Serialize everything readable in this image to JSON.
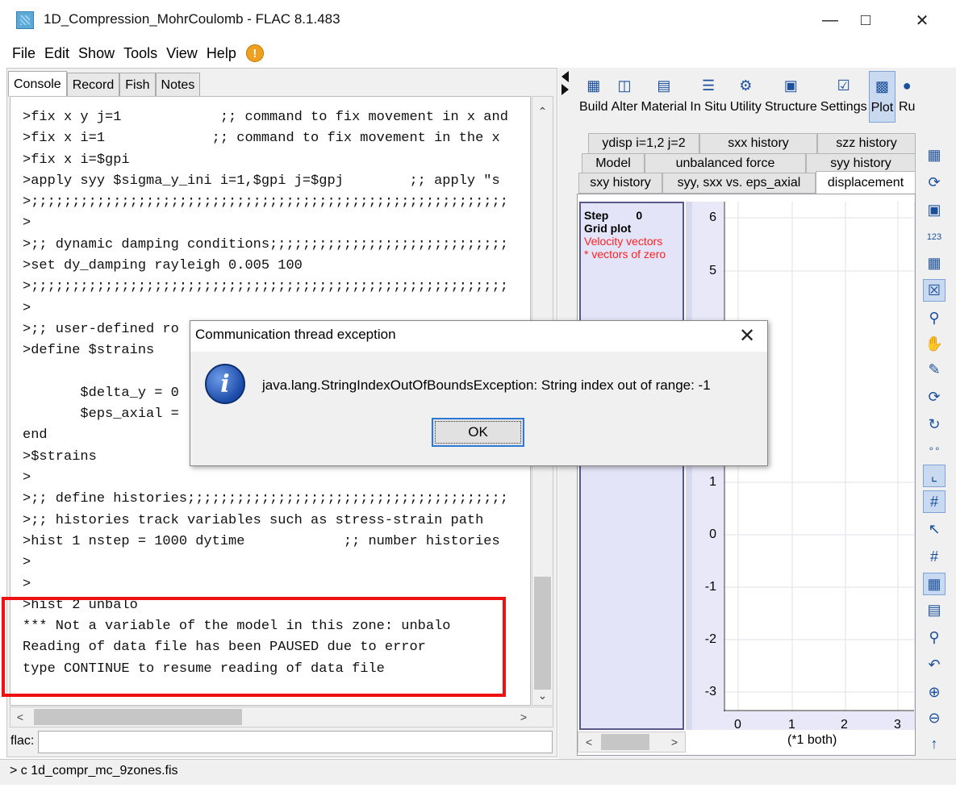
{
  "window": {
    "title": "1D_Compression_MohrCoulomb - FLAC 8.1.483"
  },
  "menu": [
    "File",
    "Edit",
    "Show",
    "Tools",
    "View",
    "Help"
  ],
  "console": {
    "tabs": [
      "Console",
      "Record",
      "Fish",
      "Notes"
    ],
    "lines": [
      ">fix x y j=1            ;; command to fix movement in x and",
      ">fix x i=1             ;; command to fix movement in the x",
      ">fix x i=$gpi",
      ">apply syy $sigma_y_ini i=1,$gpi j=$gpj        ;; apply \"s",
      ">;;;;;;;;;;;;;;;;;;;;;;;;;;;;;;;;;;;;;;;;;;;;;;;;;;;;;;;;;;",
      ">",
      ">;; dynamic damping conditions;;;;;;;;;;;;;;;;;;;;;;;;;;;;;",
      ">set dy_damping rayleigh 0.005 100",
      ">;;;;;;;;;;;;;;;;;;;;;;;;;;;;;;;;;;;;;;;;;;;;;;;;;;;;;;;;;;",
      ">",
      ">;; user-defined ro",
      ">define $strains",
      "",
      "       $delta_y = 0",
      "       $eps_axial =",
      "end",
      ">$strains",
      ">",
      ">;; define histories;;;;;;;;;;;;;;;;;;;;;;;;;;;;;;;;;;;;;;;",
      ">;; histories track variables such as stress-strain path",
      ">hist 1 nstep = 1000 dytime            ;; number histories",
      ">",
      ">",
      ">hist 2 unbalo",
      "*** Not a variable of the model in this zone: unbalo",
      "Reading of data file has been PAUSED due to error",
      "type CONTINUE to resume reading of data file"
    ],
    "command_label": "flac:",
    "command_value": ""
  },
  "status_bar": "> c 1d_compr_mc_9zones.fis",
  "toolbar": [
    "Build",
    "Alter",
    "Material",
    "In Situ",
    "Utility",
    "Structure",
    "Settings",
    "Plot",
    "Ru"
  ],
  "plot_tabs": {
    "row1": [
      "ydisp i=1,2 j=2",
      "sxx history",
      "szz history"
    ],
    "row2": [
      "Model",
      "unbalanced force",
      "syy history"
    ],
    "row3": [
      "sxy history",
      "syy, sxx vs. eps_axial",
      "displacement"
    ]
  },
  "legend": {
    "step_label": "Step",
    "step_value": "0",
    "grid": "Grid plot",
    "velocity": "Velocity vectors",
    "zero": "* vectors of zero"
  },
  "axes": {
    "y_ticks": [
      "6",
      "5",
      "1",
      "0",
      "-1",
      "-2",
      "-3"
    ],
    "x_ticks": [
      "0",
      "1",
      "2",
      "3"
    ],
    "x_unit": "(*1 both)"
  },
  "dialog": {
    "title": "Communication thread exception",
    "message": "java.lang.StringIndexOutOfBoundsException: String index out of range: -1",
    "ok_label": "OK"
  },
  "colors": {
    "highlight": "#ee1111",
    "legend_red": "#ff2020",
    "accent": "#1a4f9c"
  }
}
